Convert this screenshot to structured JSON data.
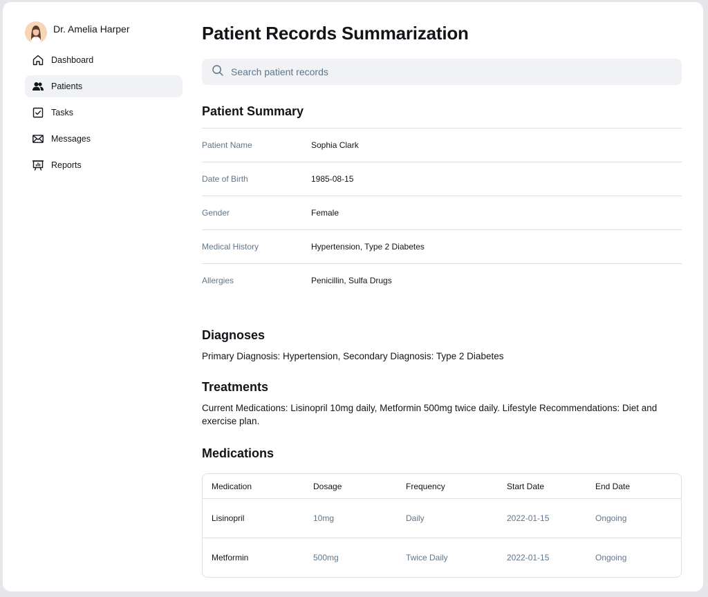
{
  "sidebar": {
    "user_name": "Dr. Amelia Harper",
    "items": [
      {
        "label": "Dashboard",
        "icon": "house-icon",
        "active": false
      },
      {
        "label": "Patients",
        "icon": "users-icon",
        "active": true
      },
      {
        "label": "Tasks",
        "icon": "checkbox-icon",
        "active": false
      },
      {
        "label": "Messages",
        "icon": "envelope-icon",
        "active": false
      },
      {
        "label": "Reports",
        "icon": "presentation-chart-icon",
        "active": false
      }
    ]
  },
  "main": {
    "title": "Patient Records Summarization",
    "search": {
      "placeholder": "Search patient records",
      "value": ""
    },
    "summary": {
      "title": "Patient Summary",
      "rows": [
        {
          "label": "Patient Name",
          "value": "Sophia Clark"
        },
        {
          "label": "Date of Birth",
          "value": "1985-08-15"
        },
        {
          "label": "Gender",
          "value": "Female"
        },
        {
          "label": "Medical History",
          "value": "Hypertension, Type 2 Diabetes"
        },
        {
          "label": "Allergies",
          "value": "Penicillin, Sulfa Drugs"
        }
      ]
    },
    "diagnoses": {
      "title": "Diagnoses",
      "text": "Primary Diagnosis: Hypertension, Secondary Diagnosis: Type 2 Diabetes"
    },
    "treatments": {
      "title": "Treatments",
      "text": "Current Medications: Lisinopril 10mg daily, Metformin 500mg twice daily. Lifestyle Recommendations: Diet and exercise plan."
    },
    "medications": {
      "title": "Medications",
      "columns": [
        "Medication",
        "Dosage",
        "Frequency",
        "Start Date",
        "End Date"
      ],
      "rows": [
        [
          "Lisinopril",
          "10mg",
          "Daily",
          "2022-01-15",
          "Ongoing"
        ],
        [
          "Metformin",
          "500mg",
          "Twice Daily",
          "2022-01-15",
          "Ongoing"
        ]
      ]
    }
  },
  "colors": {
    "muted_text": "#60758a",
    "text": "#111418",
    "surface": "#f0f2f5",
    "border": "#dbe0e5"
  }
}
